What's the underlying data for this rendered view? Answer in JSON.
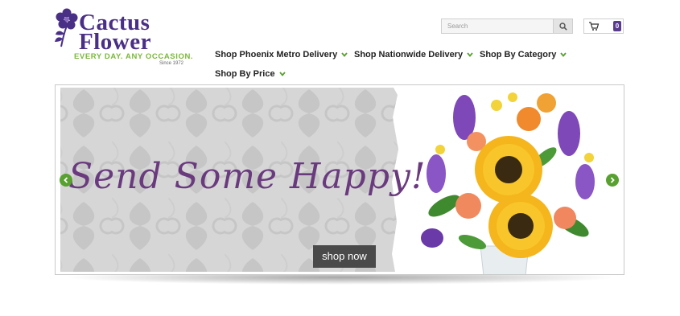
{
  "logo": {
    "line1": "Cactus",
    "line2": "Flower",
    "tagline": "EVERY DAY. ANY OCCASION.",
    "since": "Since 1972",
    "icon": "flower-icon"
  },
  "search": {
    "placeholder": "Search",
    "value": "",
    "button_icon": "search-icon"
  },
  "cart": {
    "icon": "cart-icon",
    "count": "0"
  },
  "nav": {
    "items": [
      {
        "label": "Shop Phoenix Metro Delivery",
        "icon": "chevron-down-icon"
      },
      {
        "label": "Shop Nationwide Delivery",
        "icon": "chevron-down-icon"
      },
      {
        "label": "Shop By Category",
        "icon": "chevron-down-icon"
      },
      {
        "label": "Shop By Price",
        "icon": "chevron-down-icon"
      }
    ]
  },
  "hero": {
    "headline": "Send Some Happy!",
    "button_label": "shop now",
    "prev_icon": "chevron-left-icon",
    "next_icon": "chevron-right-icon"
  },
  "colors": {
    "brand_purple": "#4a2f86",
    "tagline_green": "#7bb83a",
    "chevron_green": "#58a02f",
    "headline_purple": "#6a3a7e",
    "button_gray": "#4a4a4a"
  }
}
